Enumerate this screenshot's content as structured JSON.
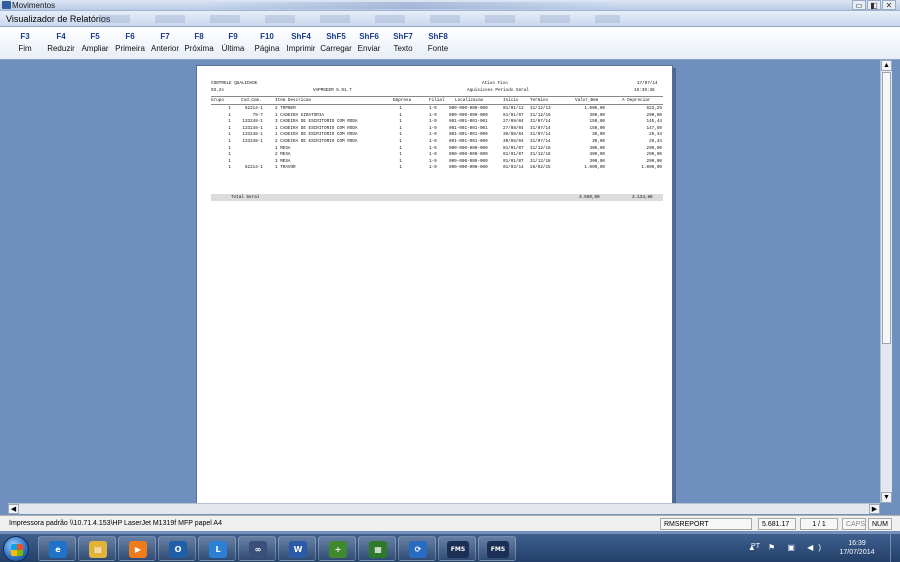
{
  "window": {
    "outer_title": "Movimentos",
    "title": "Visualizador de Relatórios",
    "controls": [
      "▭",
      "◧",
      "✕"
    ]
  },
  "toolbar": [
    {
      "key": "F3",
      "label": "Fim"
    },
    {
      "key": "F4",
      "label": "Reduzir"
    },
    {
      "key": "F5",
      "label": "Ampliar"
    },
    {
      "key": "F6",
      "label": "Primeira"
    },
    {
      "key": "F7",
      "label": "Anterior"
    },
    {
      "key": "F8",
      "label": "Próxima"
    },
    {
      "key": "F9",
      "label": "Última"
    },
    {
      "key": "F10",
      "label": "Página"
    },
    {
      "key": "ShF4",
      "label": "Imprimir"
    },
    {
      "key": "ShF5",
      "label": "Carregar"
    },
    {
      "key": "ShF6",
      "label": "Enviar"
    },
    {
      "key": "ShF7",
      "label": "Texto"
    },
    {
      "key": "ShF8",
      "label": "Fonte"
    }
  ],
  "report": {
    "company": "CONTROLE QUALIDADE",
    "version_code": "03.2s",
    "system": "VAPMGEEM 5.91.7",
    "title": "Ativo Fixo",
    "subtitle": "Aquisicoes Periodo Geral",
    "date": "17/07/14",
    "time": "16:39:38",
    "columns": [
      "Grupo",
      "Cod.Com.",
      "Item Descricao",
      "Empresa",
      "Filial",
      "Localizacao",
      "Inicio",
      "Termino",
      "Valor_Bem",
      "A Depreciar"
    ],
    "rows": [
      [
        "1",
        "62214-1",
        "2 TRPNEM",
        "1",
        "1-9",
        "000-000-000-000",
        "01/01/13",
        "31/12/13",
        "1.000,00",
        "623,25"
      ],
      [
        "1",
        "78-7",
        "1 CADEIRA GIRATORIA",
        "1",
        "1-9",
        "000-000-000-000",
        "01/01/07",
        "31/12/16",
        "300,00",
        "290,00"
      ],
      [
        "1",
        "133248-1",
        "3 CADEIRA DE ESCRITORIO COM RODA",
        "1",
        "1-9",
        "001-001-001-001",
        "27/08/04",
        "31/07/14",
        "150,00",
        "145,44"
      ],
      [
        "1",
        "133248-1",
        "1 CADEIRA DE ESCRITORIO COM RODA",
        "1",
        "1-9",
        "001-001-001-001",
        "27/08/04",
        "31/07/14",
        "150,00",
        "147,50"
      ],
      [
        "1",
        "133248-1",
        "1 CADEIRA DE ESCRITORIO COM RODA",
        "1",
        "1-9",
        "001-001-001-000",
        "30/08/04",
        "31/07/14",
        "30,00",
        "29,34"
      ],
      [
        "1",
        "133248-1",
        "2 CADEIRA DE ESCRITORIO COM RODA",
        "1",
        "1-9",
        "001-001-001-000",
        "30/08/04",
        "31/07/14",
        "30,00",
        "29,34"
      ],
      [
        "1",
        "",
        "1 MESA",
        "1",
        "1-9",
        "000-000-000-000",
        "01/01/07",
        "31/12/16",
        "300,00",
        "290,00"
      ],
      [
        "1",
        "",
        "2 MESA",
        "1",
        "1-9",
        "000-000-000-000",
        "01/01/07",
        "31/12/16",
        "300,00",
        "290,00"
      ],
      [
        "1",
        "",
        "3 MESA",
        "1",
        "1-9",
        "000-000-000-000",
        "01/01/07",
        "31/12/16",
        "300,00",
        "290,00"
      ],
      [
        "1",
        "62214-1",
        "1 TRAVOR",
        "1",
        "1-9",
        "000-000-000-000",
        "01/03/14",
        "28/02/15",
        "1.000,00",
        "1.000,00"
      ]
    ],
    "total_label": "Total Geral",
    "total_valor": "3.560,00",
    "total_depreciar": "3.134,86"
  },
  "status": {
    "printer": "Impressora padrão \\\\10.71.4.153\\HP LaserJet M1319f MFP papel A4",
    "report_name": "RMSREPORT",
    "value": "5.681.17",
    "pages": "1 / 1",
    "caps": "CAPS",
    "num": "NUM"
  },
  "taskbar": {
    "apps": [
      {
        "name": "ie-icon",
        "glyph": "e",
        "color": "#1e73c8"
      },
      {
        "name": "explorer-folder-icon",
        "glyph": "▤",
        "color": "#e2b23a"
      },
      {
        "name": "media-player-icon",
        "glyph": "▶",
        "color": "#ef7b1a"
      },
      {
        "name": "outlook-icon",
        "glyph": "O",
        "color": "#1f5fa8"
      },
      {
        "name": "lync-icon",
        "glyph": "L",
        "color": "#2b7fd4"
      },
      {
        "name": "network-app-icon",
        "glyph": "∞",
        "color": "#3a4f7a"
      },
      {
        "name": "word-icon",
        "glyph": "W",
        "color": "#2a5aa8"
      },
      {
        "name": "calculator-plus-icon",
        "glyph": "+",
        "color": "#3f8a2e"
      },
      {
        "name": "chart-app-icon",
        "glyph": "▦",
        "color": "#2e7a2a"
      },
      {
        "name": "sync-icon",
        "glyph": "⟳",
        "color": "#2a6bc2"
      },
      {
        "name": "fms-app-icon",
        "glyph": "FMS",
        "color": "#1b2f55"
      },
      {
        "name": "fms-app-icon-2",
        "glyph": "FMS",
        "color": "#1b2f55"
      }
    ],
    "language": "PT",
    "tray_icons": "▲ ⚑ ▣ ◀)",
    "time": "16:39",
    "date": "17/07/2014"
  }
}
